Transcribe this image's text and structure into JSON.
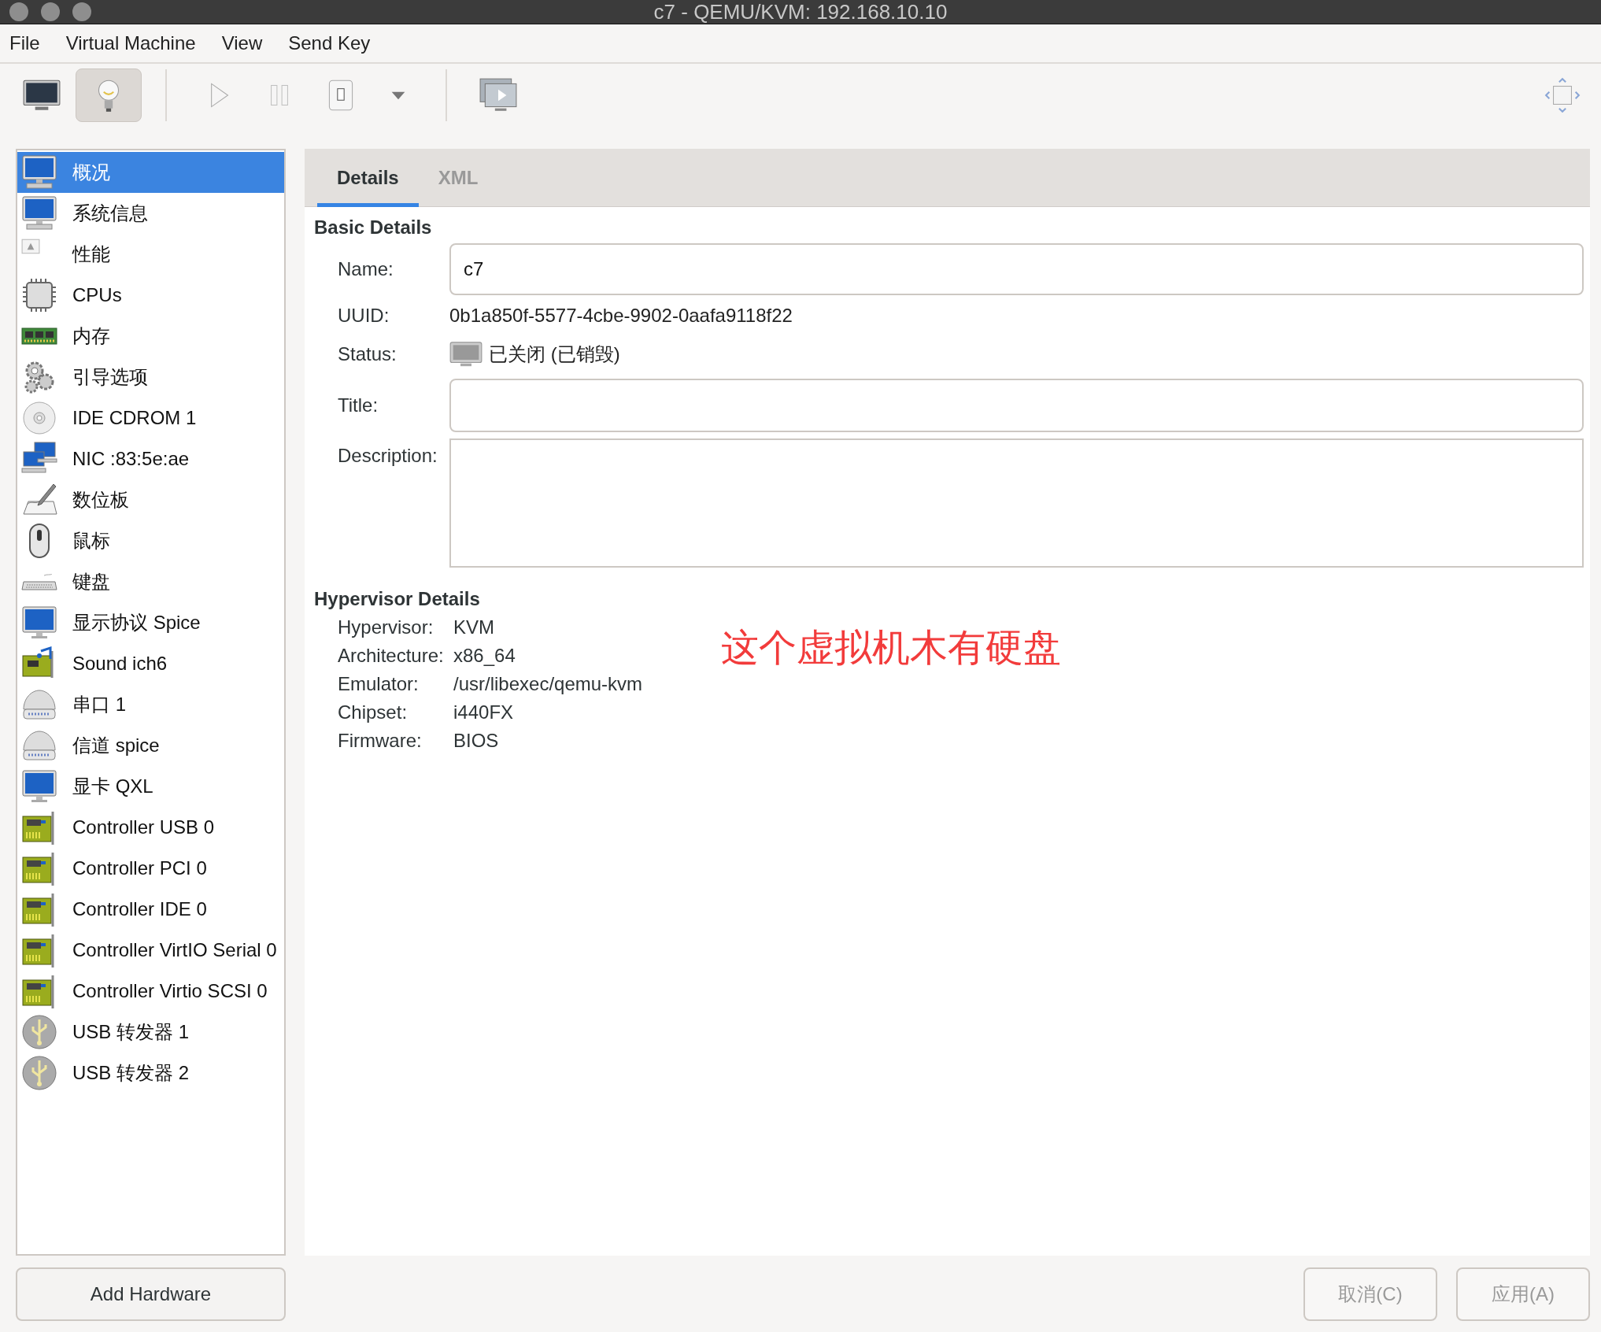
{
  "window": {
    "title": "c7 - QEMU/KVM: 192.168.10.10"
  },
  "menu": [
    "File",
    "Virtual Machine",
    "View",
    "Send Key"
  ],
  "toolbar": [
    {
      "kind": "monitor",
      "selected": false,
      "disabled": false
    },
    {
      "kind": "bulb",
      "selected": true,
      "disabled": false
    },
    {
      "kind": "separator"
    },
    {
      "kind": "play",
      "selected": false,
      "disabled": true
    },
    {
      "kind": "pause",
      "selected": false,
      "disabled": true
    },
    {
      "kind": "power",
      "selected": false,
      "disabled": false
    },
    {
      "kind": "dropdown",
      "selected": false,
      "disabled": false
    },
    {
      "kind": "separator"
    },
    {
      "kind": "console",
      "selected": false,
      "disabled": false
    }
  ],
  "sidebar": {
    "items": [
      {
        "label": "概况",
        "kind": "monitor",
        "selected": true
      },
      {
        "label": "系统信息",
        "kind": "monitor",
        "selected": false
      },
      {
        "label": "性能",
        "kind": "doc",
        "selected": false
      },
      {
        "label": "CPUs",
        "kind": "chip",
        "selected": false
      },
      {
        "label": "内存",
        "kind": "memory",
        "selected": false
      },
      {
        "label": "引导选项",
        "kind": "gears",
        "selected": false
      },
      {
        "label": "IDE CDROM 1",
        "kind": "disc",
        "selected": false
      },
      {
        "label": "NIC :83:5e:ae",
        "kind": "network",
        "selected": false
      },
      {
        "label": "数位板",
        "kind": "tablet",
        "selected": false
      },
      {
        "label": "鼠标",
        "kind": "mouse",
        "selected": false
      },
      {
        "label": "键盘",
        "kind": "keyboard",
        "selected": false
      },
      {
        "label": "显示协议 Spice",
        "kind": "screen",
        "selected": false
      },
      {
        "label": "Sound ich6",
        "kind": "sound",
        "selected": false
      },
      {
        "label": "串口 1",
        "kind": "serial",
        "selected": false
      },
      {
        "label": "信道 spice",
        "kind": "serial",
        "selected": false
      },
      {
        "label": "显卡 QXL",
        "kind": "screen",
        "selected": false
      },
      {
        "label": "Controller USB 0",
        "kind": "card",
        "selected": false
      },
      {
        "label": "Controller PCI 0",
        "kind": "card",
        "selected": false
      },
      {
        "label": "Controller IDE 0",
        "kind": "card",
        "selected": false
      },
      {
        "label": "Controller VirtIO Serial 0",
        "kind": "card",
        "selected": false
      },
      {
        "label": "Controller Virtio SCSI 0",
        "kind": "card",
        "selected": false
      },
      {
        "label": "USB 转发器 1",
        "kind": "usb",
        "selected": false
      },
      {
        "label": "USB 转发器 2",
        "kind": "usb",
        "selected": false
      }
    ]
  },
  "add_hardware_button": {
    "label": "Add Hardware",
    "disabled": false
  },
  "tabs": [
    {
      "label": "Details",
      "selected": true
    },
    {
      "label": "XML",
      "selected": false
    }
  ],
  "basic_details": {
    "heading": "Basic Details",
    "name": {
      "label": "Name:",
      "value": "c7"
    },
    "uuid": {
      "label": "UUID:",
      "value": "0b1a850f-5577-4cbe-9902-0aafa9118f22"
    },
    "status": {
      "label": "Status:",
      "value": "已关闭 (已销毁)"
    },
    "title": {
      "label": "Title:"
    },
    "description": {
      "label": "Description:"
    }
  },
  "hypervisor_details": {
    "heading": "Hypervisor Details",
    "rows": [
      {
        "label": "Hypervisor:",
        "value": "KVM"
      },
      {
        "label": "Architecture:",
        "value": "x86_64"
      },
      {
        "label": "Emulator:",
        "value": "/usr/libexec/qemu-kvm"
      },
      {
        "label": "Chipset:",
        "value": "i440FX"
      },
      {
        "label": "Firmware:",
        "value": "BIOS"
      }
    ]
  },
  "annotation": "这个虚拟机木有硬盘",
  "buttons": [
    {
      "label": "取消(C)",
      "disabled": true
    },
    {
      "label": "应用(A)",
      "disabled": true
    }
  ]
}
